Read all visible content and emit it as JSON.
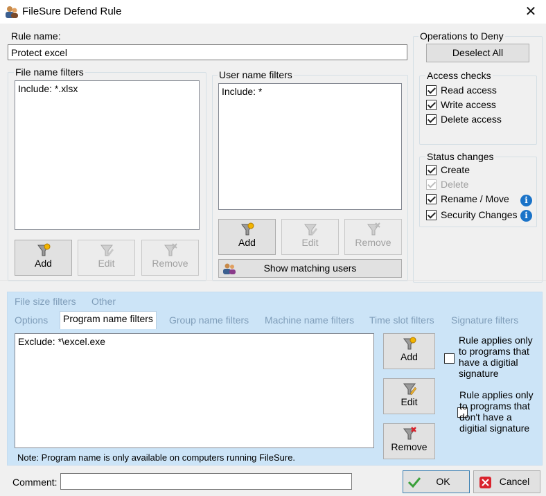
{
  "window": {
    "title": "FileSure Defend Rule",
    "close_glyph": "✕"
  },
  "rule_name": {
    "label": "Rule name:",
    "value": "Protect excel"
  },
  "file_name_filters": {
    "label": "File name filters",
    "items": [
      "Include: *.xlsx"
    ],
    "buttons": {
      "add": "Add",
      "edit": "Edit",
      "remove": "Remove"
    }
  },
  "user_name_filters": {
    "label": "User name filters",
    "items": [
      "Include: *"
    ],
    "buttons": {
      "add": "Add",
      "edit": "Edit",
      "remove": "Remove"
    },
    "show_matching": "Show matching users"
  },
  "operations": {
    "label": "Operations to Deny",
    "deselect_all": "Deselect All",
    "access_checks": {
      "label": "Access checks",
      "items": [
        {
          "label": "Read access",
          "checked": true
        },
        {
          "label": "Write access",
          "checked": true
        },
        {
          "label": "Delete access",
          "checked": true
        }
      ]
    },
    "status_changes": {
      "label": "Status changes",
      "items": [
        {
          "label": "Create",
          "checked": true,
          "disabled": false
        },
        {
          "label": "Delete",
          "checked": true,
          "disabled": true
        },
        {
          "label": "Rename / Move",
          "checked": true,
          "disabled": false,
          "info": true
        },
        {
          "label": "Security Changes",
          "checked": true,
          "disabled": false,
          "info": true
        }
      ]
    }
  },
  "tabs": {
    "row1": [
      "File size filters",
      "Other"
    ],
    "row2": [
      "Options",
      "Program name filters",
      "Group name filters",
      "Machine name filters",
      "Time slot filters",
      "Signature filters"
    ],
    "active": "Program name filters"
  },
  "program_filters": {
    "items": [
      "Exclude: *\\excel.exe"
    ],
    "buttons": {
      "add": "Add",
      "edit": "Edit",
      "remove": "Remove"
    },
    "signed_option": "Rule applies only to programs that have a digitial signature",
    "unsigned_option": "Rule applies only to programs that don't have a digitial signature",
    "note": "Note: Program name is only available on computers running FileSure."
  },
  "footer": {
    "comment_label": "Comment:",
    "comment_value": "",
    "ok": "OK",
    "cancel": "Cancel"
  }
}
